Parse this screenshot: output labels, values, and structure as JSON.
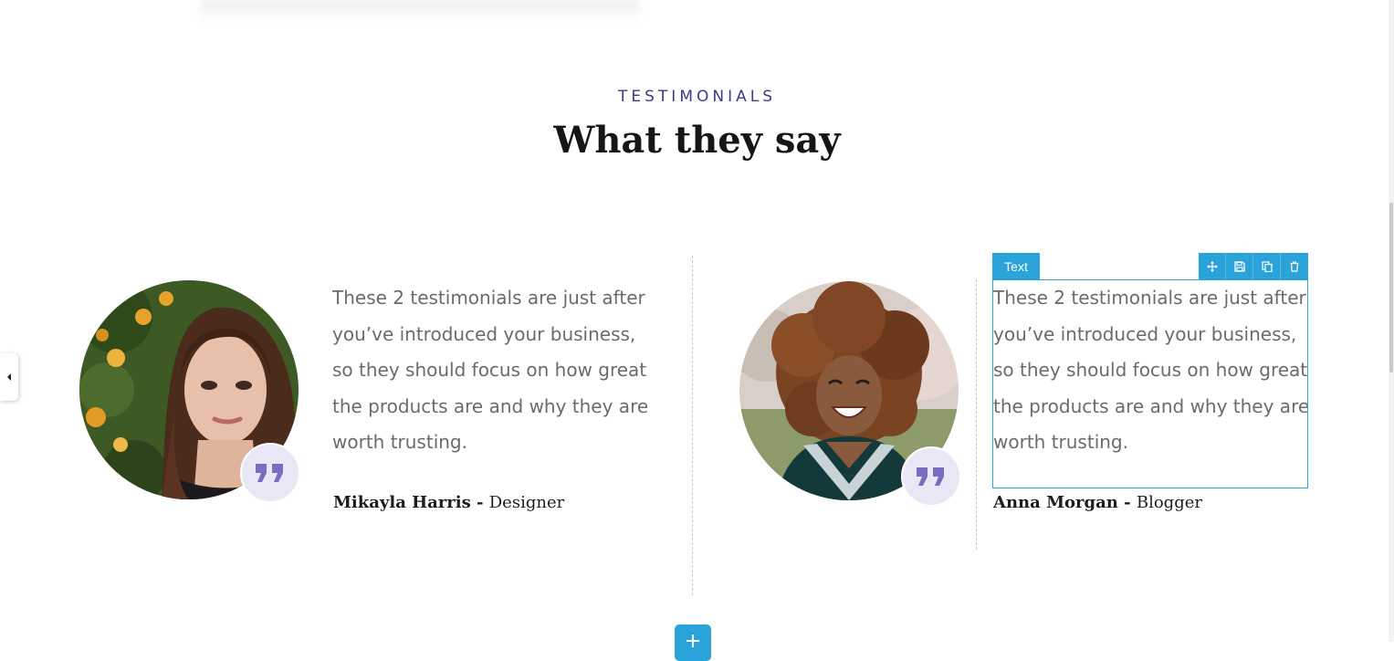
{
  "section": {
    "eyebrow": "TESTIMONIALS",
    "heading": "What they say"
  },
  "testimonials": [
    {
      "quote": "These 2 testimonials are just after you’ve introduced your business, so they should focus on how great the products are and why they are worth trusting.",
      "name": "Mikayla Harris",
      "separator": " - ",
      "role": "Designer",
      "photo": "photo-woman-long-brown-hair-with-orange-tree",
      "badge_icon": "quote-icon"
    },
    {
      "quote": "These 2 testimonials are just after you’ve introduced your business, so they should focus on how great the products are and why they are worth trusting.",
      "name": "Anna Morgan",
      "separator": " - ",
      "role": "Blogger",
      "photo": "photo-smiling-woman-curly-hair",
      "badge_icon": "quote-icon"
    }
  ],
  "editor": {
    "element_label": "Text",
    "tools": [
      "move-icon",
      "save-icon",
      "duplicate-icon",
      "delete-icon"
    ],
    "add_icon": "plus-icon",
    "left_toggle_icon": "caret-left-icon"
  },
  "colors": {
    "accent": "#29a3d9",
    "eyebrow": "#3b3a8c",
    "badge_bg": "#e9e6f6",
    "quote_icon": "#7a6cc0",
    "body_text": "#6b6b6b"
  }
}
